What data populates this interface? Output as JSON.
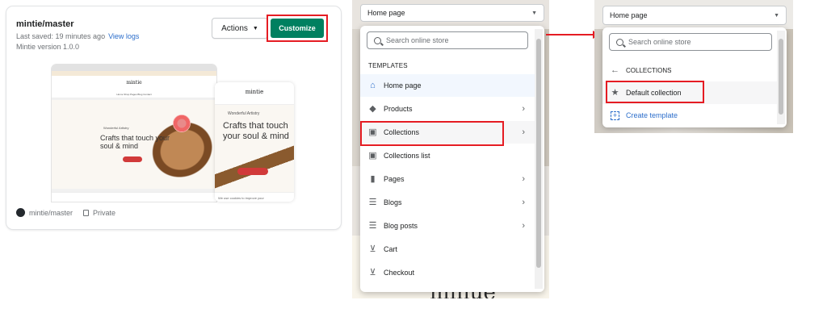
{
  "theme_card": {
    "name": "mintie/master",
    "last_saved": "Last saved: 19 minutes ago",
    "view_logs": "View logs",
    "version": "Mintie version 1.0.0",
    "actions_label": "Actions",
    "customize_label": "Customize",
    "repo": "mintie/master",
    "visibility": "Private",
    "preview": {
      "logo": "mintie",
      "nav": "Home   Shop   Pages   Blog   Contact",
      "hero_sub": "Wonderful Artistry",
      "hero_title": "Crafts that touch your soul & mind",
      "mobile_logo": "mintie",
      "mobile_sub": "Wonderful Artistry",
      "mobile_title": "Crafts that touch your soul & mind",
      "mobile_footer": "We use cookies to improve your"
    },
    "colors": {
      "customize_bg": "#008060",
      "highlight": "#e51c23"
    }
  },
  "template_picker": {
    "selected_page": "Home page",
    "search_placeholder": "Search online store",
    "section_label": "TEMPLATES",
    "items": [
      {
        "label": "Home page",
        "icon": "home-icon",
        "has_children": false,
        "active": true
      },
      {
        "label": "Products",
        "icon": "tag-icon",
        "has_children": true
      },
      {
        "label": "Collections",
        "icon": "collection-icon",
        "has_children": true,
        "highlighted": true
      },
      {
        "label": "Collections list",
        "icon": "collection-icon",
        "has_children": false
      },
      {
        "label": "Pages",
        "icon": "page-icon",
        "has_children": true
      },
      {
        "label": "Blogs",
        "icon": "blog-icon",
        "has_children": true
      },
      {
        "label": "Blog posts",
        "icon": "blog-icon",
        "has_children": true
      },
      {
        "label": "Cart",
        "icon": "cart-icon",
        "has_children": false
      },
      {
        "label": "Checkout",
        "icon": "cart-icon",
        "has_children": false
      }
    ],
    "background_text": "minue"
  },
  "collections_picker": {
    "selected_page": "Home page",
    "search_placeholder": "Search online store",
    "back_label": "COLLECTIONS",
    "items": [
      {
        "label": "Default collection",
        "icon": "star-icon",
        "highlighted": true
      },
      {
        "label": "Create template",
        "icon": "plus-icon",
        "link": true
      }
    ]
  }
}
